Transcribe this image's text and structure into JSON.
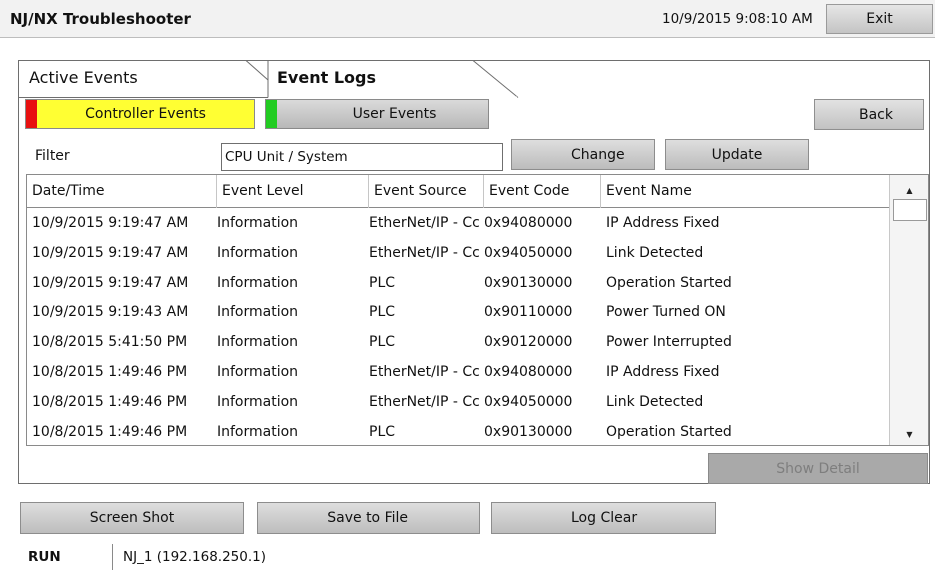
{
  "window": {
    "title": "NJ/NX Troubleshooter",
    "datetime": "10/9/2015 9:08:10 AM",
    "exit_label": "Exit"
  },
  "tabs": [
    {
      "label": "Active Events",
      "active": false
    },
    {
      "label": "Event Logs",
      "active": true
    }
  ],
  "event_types": {
    "controller": {
      "label": "Controller Events",
      "selected": true,
      "marker_color": "#e81010",
      "color": "#ffff33"
    },
    "user": {
      "label": "User Events",
      "selected": false,
      "marker_color": "#22cc22"
    }
  },
  "back_label": "Back",
  "filter": {
    "label": "Filter",
    "value": "CPU Unit / System",
    "change_label": "Change",
    "update_label": "Update"
  },
  "table": {
    "columns": [
      "Date/Time",
      "Event Level",
      "Event Source",
      "Event Code",
      "Event Name"
    ],
    "rows": [
      [
        "10/9/2015 9:19:47 AM",
        "Information",
        "EtherNet/IP - Cc",
        "0x94080000",
        "IP Address Fixed"
      ],
      [
        "10/9/2015 9:19:47 AM",
        "Information",
        "EtherNet/IP - Cc",
        "0x94050000",
        "Link Detected"
      ],
      [
        "10/9/2015 9:19:47 AM",
        "Information",
        "PLC",
        "0x90130000",
        "Operation Started"
      ],
      [
        "10/9/2015 9:19:43 AM",
        "Information",
        "PLC",
        "0x90110000",
        "Power Turned ON"
      ],
      [
        "10/8/2015 5:41:50 PM",
        "Information",
        "PLC",
        "0x90120000",
        "Power Interrupted"
      ],
      [
        "10/8/2015 1:49:46 PM",
        "Information",
        "EtherNet/IP - Cc",
        "0x94080000",
        "IP Address Fixed"
      ],
      [
        "10/8/2015 1:49:46 PM",
        "Information",
        "EtherNet/IP - Cc",
        "0x94050000",
        "Link Detected"
      ],
      [
        "10/8/2015 1:49:46 PM",
        "Information",
        "PLC",
        "0x90130000",
        "Operation Started"
      ]
    ]
  },
  "show_detail_label": "Show Detail",
  "bottom_buttons": {
    "screenshot_label": "Screen Shot",
    "save_label": "Save to File",
    "clear_label": "Log Clear"
  },
  "status": {
    "mode": "RUN",
    "connection": "NJ_1 (192.168.250.1)"
  },
  "icons": {
    "scroll_up": "triangle-up",
    "scroll_down": "triangle-down"
  }
}
